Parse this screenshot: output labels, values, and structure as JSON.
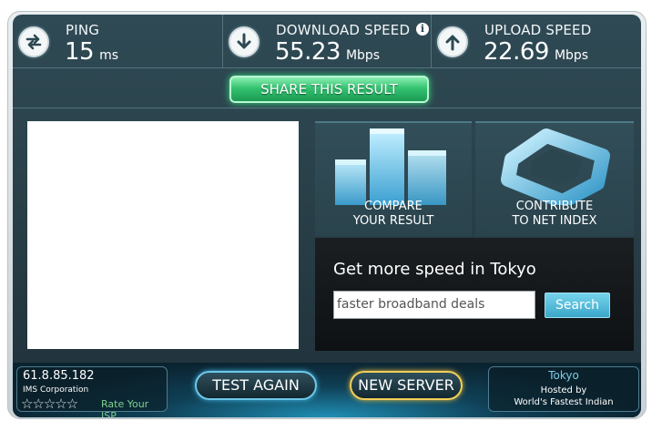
{
  "stats": {
    "ping": {
      "label": "PING",
      "value": "15",
      "unit": "ms",
      "icon": "ping-arrows-icon"
    },
    "download": {
      "label": "DOWNLOAD SPEED",
      "value": "55.23",
      "unit": "Mbps",
      "icon": "download-arrow-icon"
    },
    "upload": {
      "label": "UPLOAD SPEED",
      "value": "22.69",
      "unit": "Mbps",
      "icon": "upload-arrow-icon"
    },
    "info_glyph": "i"
  },
  "share": {
    "label": "SHARE THIS RESULT"
  },
  "tiles": {
    "compare": {
      "line1": "COMPARE",
      "line2": "YOUR RESULT"
    },
    "contribute": {
      "line1": "CONTRIBUTE",
      "line2": "TO NET INDEX"
    }
  },
  "speed_offer": {
    "title": "Get more speed in Tokyo",
    "input_value": "faster broadband deals",
    "search_label": "Search"
  },
  "isp": {
    "ip": "61.8.85.182",
    "name": "IMS Corporation",
    "stars": "☆☆☆☆☆",
    "rate_label": "Rate Your ISP"
  },
  "actions": {
    "test_again": "TEST AGAIN",
    "new_server": "NEW SERVER"
  },
  "host": {
    "city": "Tokyo",
    "hosted_by": "Hosted by",
    "name": "World's Fastest Indian"
  },
  "colors": {
    "panel": "#294049",
    "share_green": "#33c270",
    "search_blue": "#3aa7c8",
    "test_outline": "#6ec8e8",
    "server_outline": "#f2cf5b"
  }
}
